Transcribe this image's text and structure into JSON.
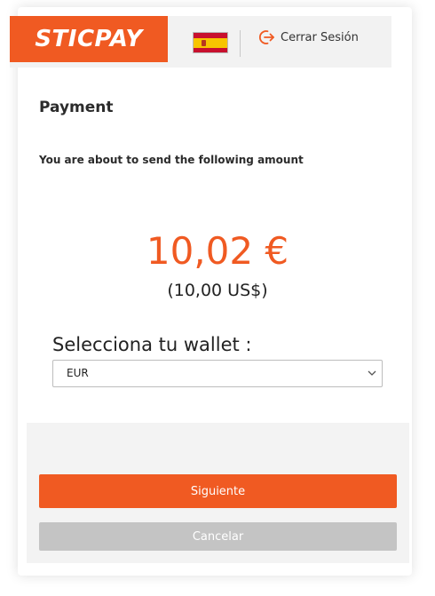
{
  "header": {
    "logo_text": "STICPAY",
    "flag_icon": "spain-flag-icon",
    "logout_icon": "logout-arrow-icon",
    "logout_label": "Cerrar Sesión"
  },
  "content": {
    "title": "Payment",
    "subtitle": "You are about to send the following amount",
    "amount": "10,02 €",
    "amount_usd": "(10,00 US$)",
    "wallet_label": "Selecciona tu wallet :",
    "wallet_selected": "EUR",
    "wallet_chevron_icon": "chevron-down-icon"
  },
  "actions": {
    "next_label": "Siguiente",
    "cancel_label": "Cancelar"
  },
  "colors": {
    "brand": "#f05a22",
    "cancel": "#c4c4c4",
    "panel": "#f2f2f2"
  }
}
